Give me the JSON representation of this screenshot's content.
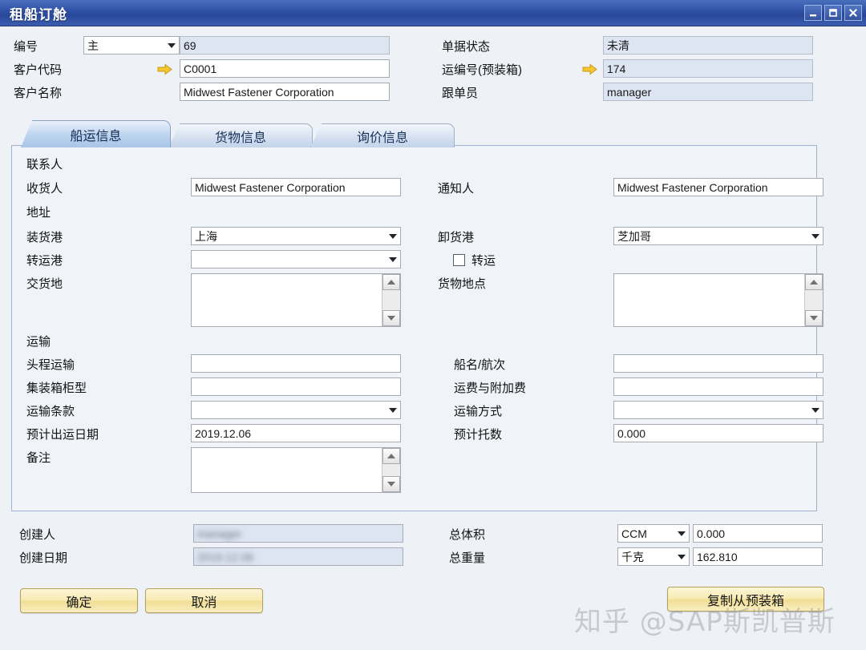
{
  "window": {
    "title": "租船订舱",
    "controls": [
      {
        "name": "minimize",
        "glyph": "minimize-icon"
      },
      {
        "name": "maximize",
        "glyph": "maximize-icon"
      },
      {
        "name": "close",
        "glyph": "close-icon"
      }
    ]
  },
  "header": {
    "left": [
      {
        "label": "编号",
        "combo_value": "主",
        "value": "69",
        "readonly": true,
        "has_combo": true
      },
      {
        "label": "客户代码",
        "value": "C0001",
        "readonly": false,
        "has_link_arrow": true
      },
      {
        "label": "客户名称",
        "value": "Midwest Fastener Corporation",
        "readonly": false
      }
    ],
    "right": [
      {
        "label": "单据状态",
        "value": "未清",
        "readonly": true
      },
      {
        "label": "运编号(预装箱)",
        "value": "174",
        "readonly": true,
        "has_link_arrow": true
      },
      {
        "label": "跟单员",
        "value": "manager",
        "readonly": true
      }
    ]
  },
  "tabs": [
    {
      "label": "船运信息",
      "active": true
    },
    {
      "label": "货物信息",
      "active": false
    },
    {
      "label": "询价信息",
      "active": false
    }
  ],
  "panel": {
    "sections": {
      "contact": "联系人",
      "address": "地址",
      "transport": "运输"
    },
    "fields": {
      "consignee": {
        "label": "收货人",
        "value": "Midwest Fastener Corporation"
      },
      "notify_party": {
        "label": "通知人",
        "value": "Midwest Fastener Corporation"
      },
      "load_port": {
        "label": "装货港",
        "value": "上海"
      },
      "discharge_port": {
        "label": "卸货港",
        "value": "芝加哥"
      },
      "transit_port": {
        "label": "转运港",
        "value": ""
      },
      "transship_checkbox": {
        "label": "转运",
        "checked": false
      },
      "delivery_place": {
        "label": "交货地",
        "value": ""
      },
      "cargo_location": {
        "label": "货物地点",
        "value": ""
      },
      "precarriage": {
        "label": "头程运输",
        "value": ""
      },
      "vessel_voyage": {
        "label": "船名/航次",
        "value": ""
      },
      "container_type": {
        "label": "集装箱柜型",
        "value": ""
      },
      "freight_charges": {
        "label": "运费与附加费",
        "value": ""
      },
      "transport_terms": {
        "label": "运输条款",
        "value": ""
      },
      "transport_mode": {
        "label": "运输方式",
        "value": ""
      },
      "etd": {
        "label": "预计出运日期",
        "value": "2019.12.06"
      },
      "estimated_pallets": {
        "label": "预计托数",
        "value": "0.000"
      },
      "remarks": {
        "label": "备注",
        "value": ""
      }
    }
  },
  "footer": {
    "created_by": {
      "label": "创建人",
      "value": "manager",
      "blurred": true
    },
    "created_date": {
      "label": "创建日期",
      "value": "2019.12.06",
      "blurred": true
    },
    "total_volume": {
      "label": "总体积",
      "unit": "CCM",
      "value": "0.000"
    },
    "total_weight": {
      "label": "总重量",
      "unit": "千克",
      "value": "162.810"
    },
    "buttons": {
      "confirm": "确定",
      "cancel": "取消",
      "copy_from_prepack": "复制从预装箱"
    }
  },
  "watermark": "知乎 @SAP斯凯普斯"
}
